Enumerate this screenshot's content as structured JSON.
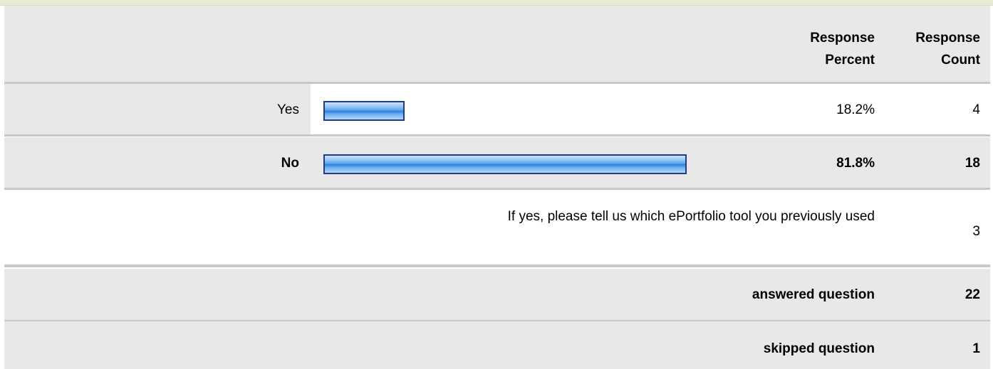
{
  "header": {
    "response_percent": "Response Percent",
    "response_count": "Response Count"
  },
  "rows": [
    {
      "label": "Yes",
      "percent_text": "18.2%",
      "count_text": "4",
      "percent": 18.2,
      "bold": false
    },
    {
      "label": "No",
      "percent_text": "81.8%",
      "count_text": "18",
      "percent": 81.8,
      "bold": true
    }
  ],
  "other": {
    "text": "If yes, please tell us which ePortfolio tool you previously used",
    "count": "3"
  },
  "summary": {
    "answered_label": "answered question",
    "answered_value": "22",
    "skipped_label": "skipped question",
    "skipped_value": "1"
  },
  "colors": {
    "bar_border": "#1f3b8c",
    "bar_fill": "#5ea7ec",
    "row_shade": "#e8e8e8",
    "top_strip": "#e6ebd3"
  }
}
